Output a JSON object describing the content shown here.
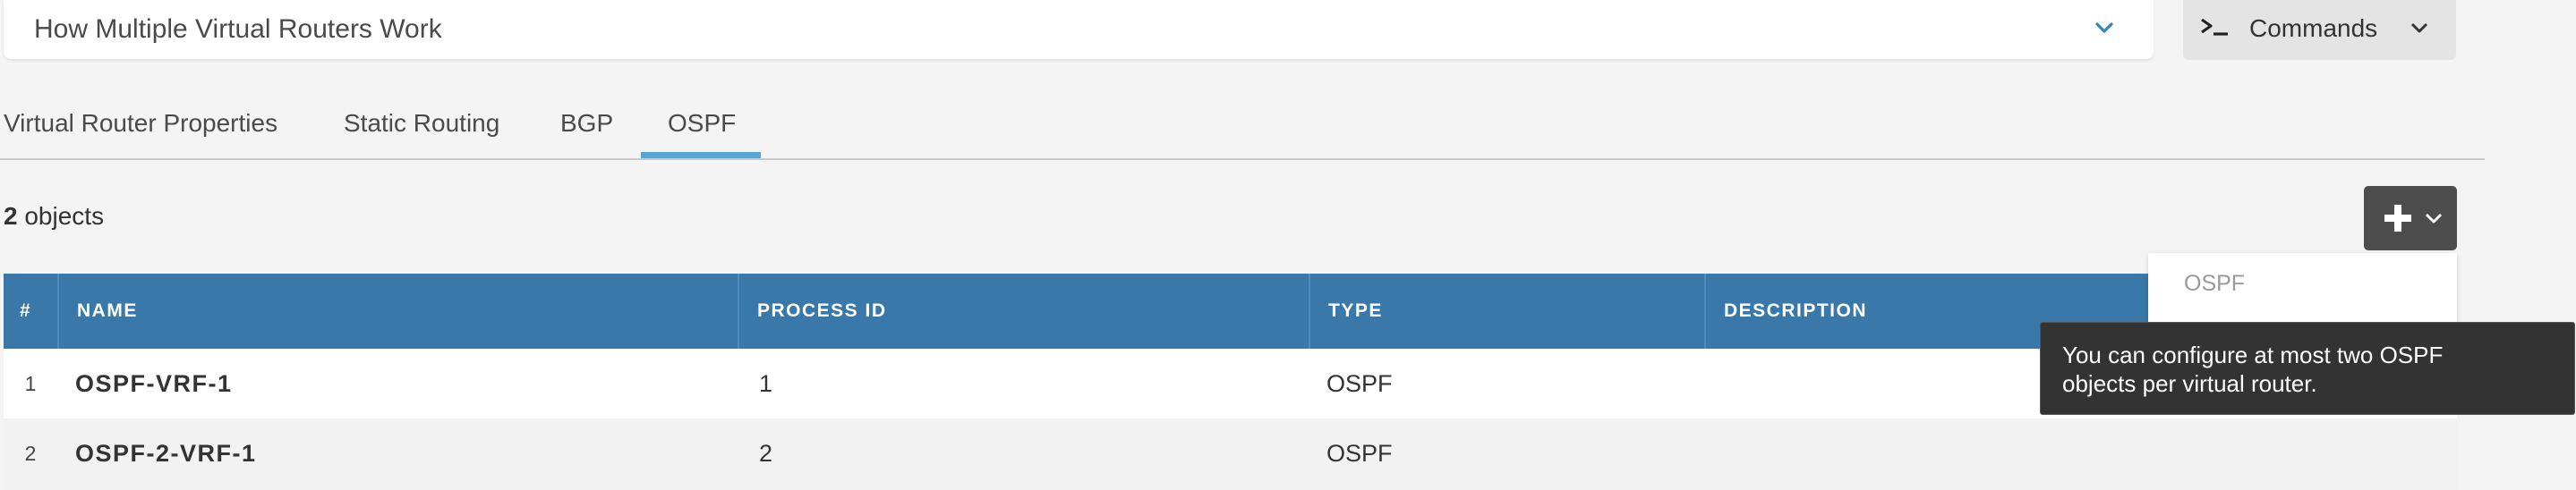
{
  "header": {
    "select_label": "How Multiple Virtual Routers Work",
    "commands_label": "Commands"
  },
  "tabs": [
    {
      "label": "Virtual Router Properties",
      "active": false
    },
    {
      "label": "Static Routing",
      "active": false
    },
    {
      "label": "BGP",
      "active": false
    },
    {
      "label": "OSPF",
      "active": true
    }
  ],
  "summary": {
    "count": "2",
    "count_suffix": " objects"
  },
  "table": {
    "columns": [
      "#",
      "NAME",
      "PROCESS ID",
      "TYPE",
      "DESCRIPTION"
    ],
    "rows": [
      {
        "index": "1",
        "name": "OSPF-VRF-1",
        "process_id": "1",
        "type": "OSPF",
        "description": ""
      },
      {
        "index": "2",
        "name": "OSPF-2-VRF-1",
        "process_id": "2",
        "type": "OSPF",
        "description": ""
      }
    ]
  },
  "add_menu": {
    "items": [
      "OSPF"
    ]
  },
  "tooltip": {
    "text_line1": "You can configure at most two OSPF",
    "text_line2": "objects per virtual router."
  },
  "colors": {
    "table_header": "#3a78aa",
    "tab_active_underline": "#5aa4d6",
    "add_button": "#4d4d4d",
    "tooltip_bg": "#333333"
  },
  "icons": {
    "select_chevron": "chevron-down-icon",
    "commands_prompt": "terminal-prompt-icon",
    "add": "plus-icon"
  }
}
